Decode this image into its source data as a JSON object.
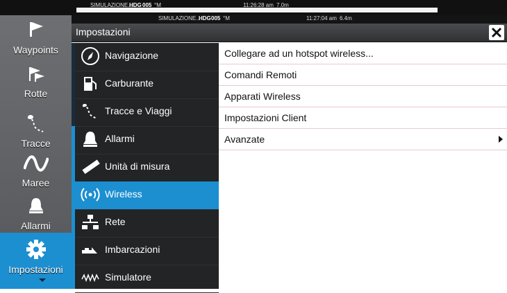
{
  "status_bar_back": {
    "mode": "SIMULAZIONE...",
    "hdg_label": "HDG",
    "hdg_value": "005",
    "hdg_unit": "°M",
    "time": "11:26:28 am",
    "extra": "7.0m"
  },
  "status_bar_front": {
    "mode": "SIMULAZIONE...",
    "hdg_label": "HDG",
    "hdg_value": "005",
    "hdg_unit": "°M",
    "time": "11:27:04 am",
    "extra": "6.4m"
  },
  "sidebar": {
    "items": [
      {
        "label": "Waypoints",
        "icon": "flag-icon"
      },
      {
        "label": "Rotte",
        "icon": "route-flags-icon"
      },
      {
        "label": "Tracce",
        "icon": "track-icon"
      },
      {
        "label": "Maree",
        "icon": "wave-icon"
      },
      {
        "label": "Allarmi",
        "icon": "bell-icon"
      },
      {
        "label": "Impostazioni",
        "icon": "gear-icon",
        "active": true
      }
    ]
  },
  "dialog": {
    "title": "Impostazioni",
    "close_label": "close",
    "menu": [
      {
        "label": "Navigazione",
        "icon": "compass-icon"
      },
      {
        "label": "Carburante",
        "icon": "fuel-pump-icon"
      },
      {
        "label": "Tracce e Viaggi",
        "icon": "trail-icon"
      },
      {
        "label": "Allarmi",
        "icon": "bell-icon"
      },
      {
        "label": "Unità di misura",
        "icon": "ruler-icon"
      },
      {
        "label": "Wireless",
        "icon": "wireless-icon",
        "selected": true
      },
      {
        "label": "Rete",
        "icon": "network-icon"
      },
      {
        "label": "Imbarcazioni",
        "icon": "vessels-icon"
      },
      {
        "label": "Simulatore",
        "icon": "simulator-icon"
      }
    ],
    "options": [
      {
        "label": "Collegare ad un hotspot wireless..."
      },
      {
        "label": "Comandi Remoti"
      },
      {
        "label": "Apparati Wireless"
      },
      {
        "label": "Impostazioni Client"
      },
      {
        "label": "Avanzate",
        "has_submenu": true
      }
    ]
  },
  "colors": {
    "accent": "#1c8fd1",
    "menu_bg": "#222426",
    "sidebar_bg": "#616366"
  }
}
